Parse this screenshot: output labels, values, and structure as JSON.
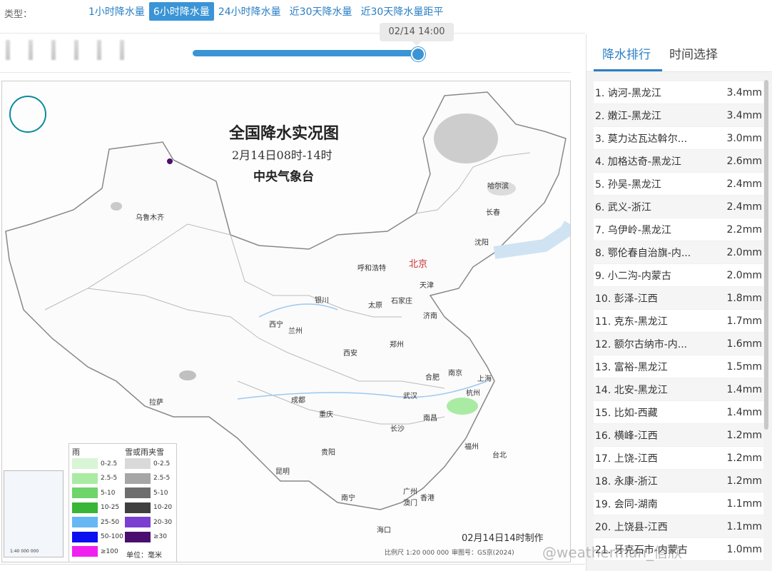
{
  "topbar": {
    "type_label": "类型：",
    "tabs": [
      {
        "label": "1小时降水量",
        "active": false
      },
      {
        "label": "6小时降水量",
        "active": true
      },
      {
        "label": "24小时降水量",
        "active": false
      },
      {
        "label": "近30天降水量",
        "active": false
      },
      {
        "label": "近30天降水量距平",
        "active": false
      }
    ]
  },
  "slider": {
    "tooltip": "02/14 14:00",
    "position_fraction": 1.0
  },
  "map": {
    "title": "全国降水实况图",
    "subtitle": "2月14日08时-14时",
    "org": "中央气象台",
    "made_time": "02月14日14时制作",
    "scale": "比例尺 1:20 000 000",
    "approval": "审图号：GS京(2024)",
    "cities": [
      "乌鲁木齐",
      "哈尔滨",
      "长春",
      "沈阳",
      "呼和浩特",
      "北京",
      "天津",
      "银川",
      "石家庄",
      "太原",
      "济南",
      "西宁",
      "兰州",
      "郑州",
      "西安",
      "合肥",
      "南京",
      "上海",
      "拉萨",
      "成都",
      "武汉",
      "杭州",
      "重庆",
      "长沙",
      "南昌",
      "福州",
      "台北",
      "贵阳",
      "昆明",
      "广州",
      "香港",
      "澳门",
      "南宁",
      "海口"
    ],
    "legend": {
      "rain_title": "雨",
      "snow_title": "雪或雨夹雪",
      "rain": [
        {
          "label": "0-2.5",
          "color": "#d8f5d5"
        },
        {
          "label": "2.5-5",
          "color": "#a9eba3"
        },
        {
          "label": "5-10",
          "color": "#6fd46a"
        },
        {
          "label": "10-25",
          "color": "#39b537"
        },
        {
          "label": "25-50",
          "color": "#67b7f5"
        },
        {
          "label": "50-100",
          "color": "#0c10f0"
        },
        {
          "label": "≥100",
          "color": "#f020f0"
        }
      ],
      "snow": [
        {
          "label": "0-2.5",
          "color": "#d9d9d9"
        },
        {
          "label": "2.5-5",
          "color": "#a6a6a6"
        },
        {
          "label": "5-10",
          "color": "#6e6e6e"
        },
        {
          "label": "10-20",
          "color": "#404040"
        },
        {
          "label": "20-30",
          "color": "#7a3fd1"
        },
        {
          "label": "≥30",
          "color": "#4a0f6e"
        }
      ],
      "unit": "单位：毫米"
    },
    "inset_scale": "1:40 000 000"
  },
  "right": {
    "tabs": [
      {
        "label": "降水排行",
        "active": true
      },
      {
        "label": "时间选择",
        "active": false
      }
    ],
    "ranking": [
      {
        "name": "1. 讷河-黑龙江",
        "value": "3.4mm"
      },
      {
        "name": "2. 嫩江-黑龙江",
        "value": "3.4mm"
      },
      {
        "name": "3. 莫力达瓦达斡尔...",
        "value": "3.0mm"
      },
      {
        "name": "4. 加格达奇-黑龙江",
        "value": "2.6mm"
      },
      {
        "name": "5. 孙吴-黑龙江",
        "value": "2.4mm"
      },
      {
        "name": "6. 武义-浙江",
        "value": "2.4mm"
      },
      {
        "name": "7. 乌伊岭-黑龙江",
        "value": "2.2mm"
      },
      {
        "name": "8. 鄂伦春自治旗-内...",
        "value": "2.0mm"
      },
      {
        "name": "9. 小二沟-内蒙古",
        "value": "2.0mm"
      },
      {
        "name": "10. 彭泽-江西",
        "value": "1.8mm"
      },
      {
        "name": "11. 克东-黑龙江",
        "value": "1.7mm"
      },
      {
        "name": "12. 额尔古纳市-内...",
        "value": "1.6mm"
      },
      {
        "name": "13. 富裕-黑龙江",
        "value": "1.5mm"
      },
      {
        "name": "14. 北安-黑龙江",
        "value": "1.4mm"
      },
      {
        "name": "15. 比如-西藏",
        "value": "1.4mm"
      },
      {
        "name": "16. 横峰-江西",
        "value": "1.2mm"
      },
      {
        "name": "17. 上饶-江西",
        "value": "1.2mm"
      },
      {
        "name": "18. 永康-浙江",
        "value": "1.2mm"
      },
      {
        "name": "19. 会同-湖南",
        "value": "1.1mm"
      },
      {
        "name": "20. 上饶县-江西",
        "value": "1.1mm"
      },
      {
        "name": "21. 牙克石市-内蒙古",
        "value": "1.0mm"
      }
    ]
  },
  "watermark": "@weatherman_信欣"
}
